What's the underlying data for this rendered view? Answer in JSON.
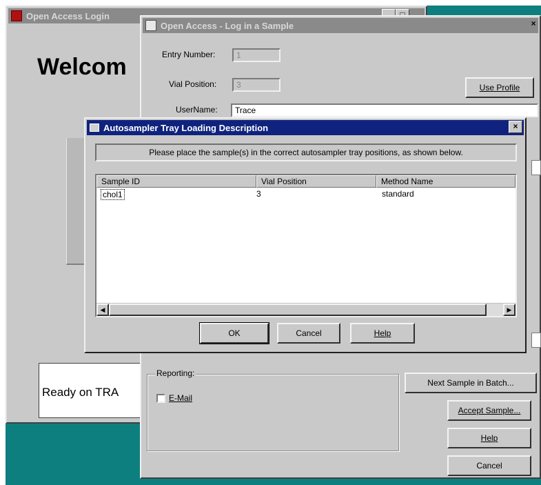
{
  "login_window": {
    "title": "Open Access Login",
    "welcome": "Welcom",
    "status": "Ready on TRA"
  },
  "sample_window": {
    "title": "Open Access - Log in a Sample",
    "entry_number_label": "Entry Number:",
    "entry_number_value": "1",
    "vial_position_label": "Vial Position:",
    "vial_position_value": "3",
    "username_label": "UserName:",
    "username_value": "Trace",
    "use_profile_label": "Use Profile",
    "reporting_label": "Reporting:",
    "email_label": "E-Mail",
    "email_checked": false,
    "next_sample_label": "Next Sample in Batch...",
    "accept_sample_label": "Accept Sample...",
    "help_label": "Help",
    "cancel_label": "Cancel"
  },
  "tray_dialog": {
    "title": "Autosampler Tray Loading Description",
    "instruction": "Please place the sample(s) in the correct autosampler tray positions, as shown below.",
    "columns": [
      "Sample ID",
      "Vial Position",
      "Method Name"
    ],
    "rows": [
      [
        "chol1",
        "3",
        "standard"
      ]
    ],
    "ok_label": "OK",
    "cancel_label": "Cancel",
    "help_label": "Help"
  },
  "colors": {
    "desktop": "#0e7f7f",
    "active_title": "#0f237e",
    "inactive_title": "#8a8a8a",
    "face": "#c9c9c9"
  }
}
